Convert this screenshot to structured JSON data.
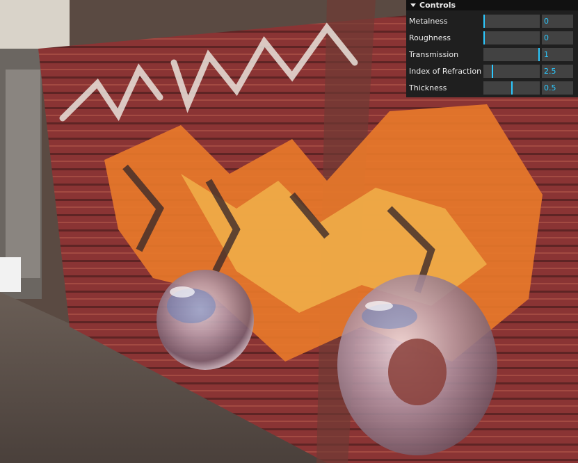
{
  "gui": {
    "title": "Controls",
    "controls": [
      {
        "label": "Metalness",
        "value": "0",
        "fraction": 0.0
      },
      {
        "label": "Roughness",
        "value": "0",
        "fraction": 0.0
      },
      {
        "label": "Transmission",
        "value": "1",
        "fraction": 1.0
      },
      {
        "label": "Index of Refraction",
        "value": "2.5",
        "fraction": 0.15
      },
      {
        "label": "Thickness",
        "value": "0.5",
        "fraction": 0.5
      }
    ],
    "accent_color": "#2cc9ff"
  }
}
